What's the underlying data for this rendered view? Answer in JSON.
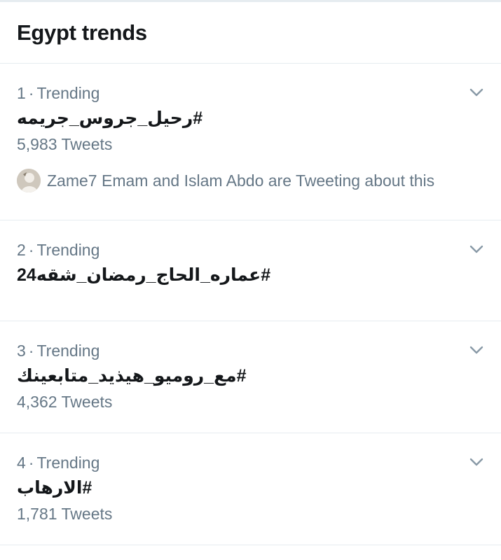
{
  "header": {
    "title": "Egypt trends"
  },
  "trends": [
    {
      "rank": "1",
      "separator": "·",
      "label": "Trending",
      "hashtag": "#رحيل_جروس_جريمه",
      "tweets": "5,983 Tweets",
      "context": "Zame7 Emam and Islam Abdo are Tweeting about this"
    },
    {
      "rank": "2",
      "separator": "·",
      "label": "Trending",
      "hashtag": "#عماره_الحاج_رمضان_شقه24"
    },
    {
      "rank": "3",
      "separator": "·",
      "label": "Trending",
      "hashtag": "#مع_روميو_هيذيد_متابعينك",
      "tweets": "4,362 Tweets"
    },
    {
      "rank": "4",
      "separator": "·",
      "label": "Trending",
      "hashtag": "#الارهاب",
      "tweets": "1,781 Tweets"
    }
  ],
  "icons": {
    "chevron": "chevron-down-icon",
    "avatar": "avatar"
  },
  "colors": {
    "text_primary": "#14171a",
    "text_secondary": "#657786",
    "divider": "#e6ecf0",
    "chevron": "#8899a6"
  }
}
